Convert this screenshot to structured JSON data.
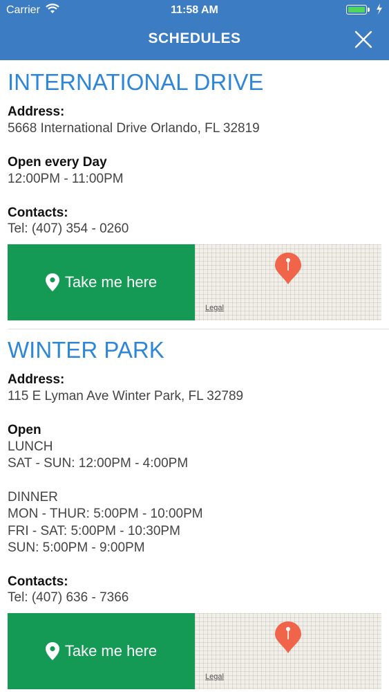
{
  "status_bar": {
    "carrier": "Carrier",
    "time": "11:58 AM",
    "battery_color": "#52d55f"
  },
  "header": {
    "title": "SCHEDULES",
    "close_icon": "close-icon",
    "background": "#3b7cc2"
  },
  "locations": [
    {
      "name": "INTERNATIONAL DRIVE",
      "address_label": "Address:",
      "address": "5668 International Drive Orlando, FL 32819",
      "hours_label": "Open every Day",
      "hours": "12:00PM - 11:00PM",
      "contacts_label": "Contacts:",
      "phone": "Tel: (407) 354 - 0260",
      "button_label": "Take me here",
      "map_legal": "Legal"
    },
    {
      "name": "WINTER PARK",
      "address_label": "Address:",
      "address": "115 E Lyman Ave Winter Park, FL 32789",
      "hours_label": "Open",
      "hours_lines": [
        "LUNCH",
        "SAT - SUN: 12:00PM - 4:00PM",
        "",
        "DINNER",
        "MON - THUR: 5:00PM - 10:00PM",
        "FRI - SAT: 5:00PM - 10:30PM",
        "SUN: 5:00PM - 9:00PM"
      ],
      "contacts_label": "Contacts:",
      "phone": "Tel: (407) 636 - 7366",
      "button_label": "Take me here",
      "map_legal": "Legal"
    }
  ],
  "colors": {
    "accent_title": "#2d86d8",
    "button_green": "#159a55",
    "map_pin": "#f0644a"
  }
}
